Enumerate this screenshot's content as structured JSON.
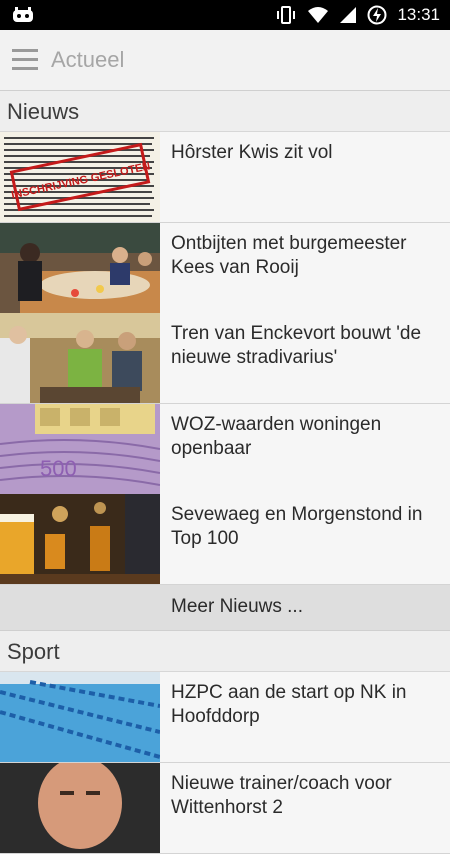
{
  "status_bar": {
    "time": "13:31"
  },
  "app_bar": {
    "title": "Actueel"
  },
  "sections": {
    "nieuws": {
      "title": "Nieuws",
      "items": [
        {
          "title": "Hôrster Kwis zit vol",
          "stamp_text": "INSCHRIJVING GESLOTEN"
        },
        {
          "title": "Ontbijten met burgemeester Kees van Rooij"
        },
        {
          "title": "Tren van Enckevort bouwt 'de nieuwe stradivarius'"
        },
        {
          "title": "WOZ-waarden woningen openbaar"
        },
        {
          "title": "Sevewaeg en Morgenstond in Top 100"
        }
      ],
      "more": "Meer Nieuws ..."
    },
    "sport": {
      "title": "Sport",
      "items": [
        {
          "title": "HZPC aan de start op NK in Hoofddorp"
        },
        {
          "title": "Nieuwe trainer/coach voor Wittenhorst 2"
        }
      ]
    }
  }
}
